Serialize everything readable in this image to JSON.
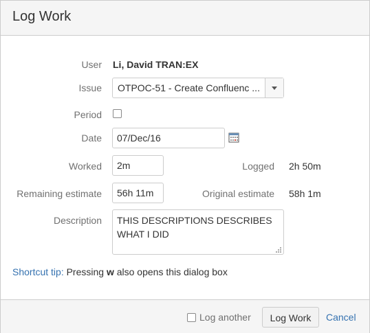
{
  "dialog": {
    "title": "Log Work"
  },
  "form": {
    "user": {
      "label": "User",
      "value": "Li, David TRAN:EX"
    },
    "issue": {
      "label": "Issue",
      "value": "OTPOC-51 - Create Confluenc ..."
    },
    "period": {
      "label": "Period",
      "checked": false
    },
    "date": {
      "label": "Date",
      "value": "07/Dec/16"
    },
    "worked": {
      "label": "Worked",
      "value": "2m"
    },
    "logged": {
      "label": "Logged",
      "value": "2h 50m"
    },
    "remaining": {
      "label": "Remaining estimate",
      "value": "56h 11m"
    },
    "original": {
      "label": "Original estimate",
      "value": "58h 1m"
    },
    "description": {
      "label": "Description",
      "value": "THIS DESCRIPTIONS DESCRIBES WHAT I DID"
    }
  },
  "tip": {
    "link": "Shortcut tip:",
    "pre": " Pressing ",
    "key": "w",
    "post": " also opens this dialog box"
  },
  "footer": {
    "log_another_label": "Log another",
    "log_another_checked": false,
    "submit_label": "Log Work",
    "cancel_label": "Cancel"
  },
  "colors": {
    "link": "#3572b0",
    "header_bg": "#f5f5f5",
    "label": "#707070"
  },
  "icons": [
    "calendar-icon",
    "dropdown-arrow-icon",
    "resize-grip-icon"
  ]
}
